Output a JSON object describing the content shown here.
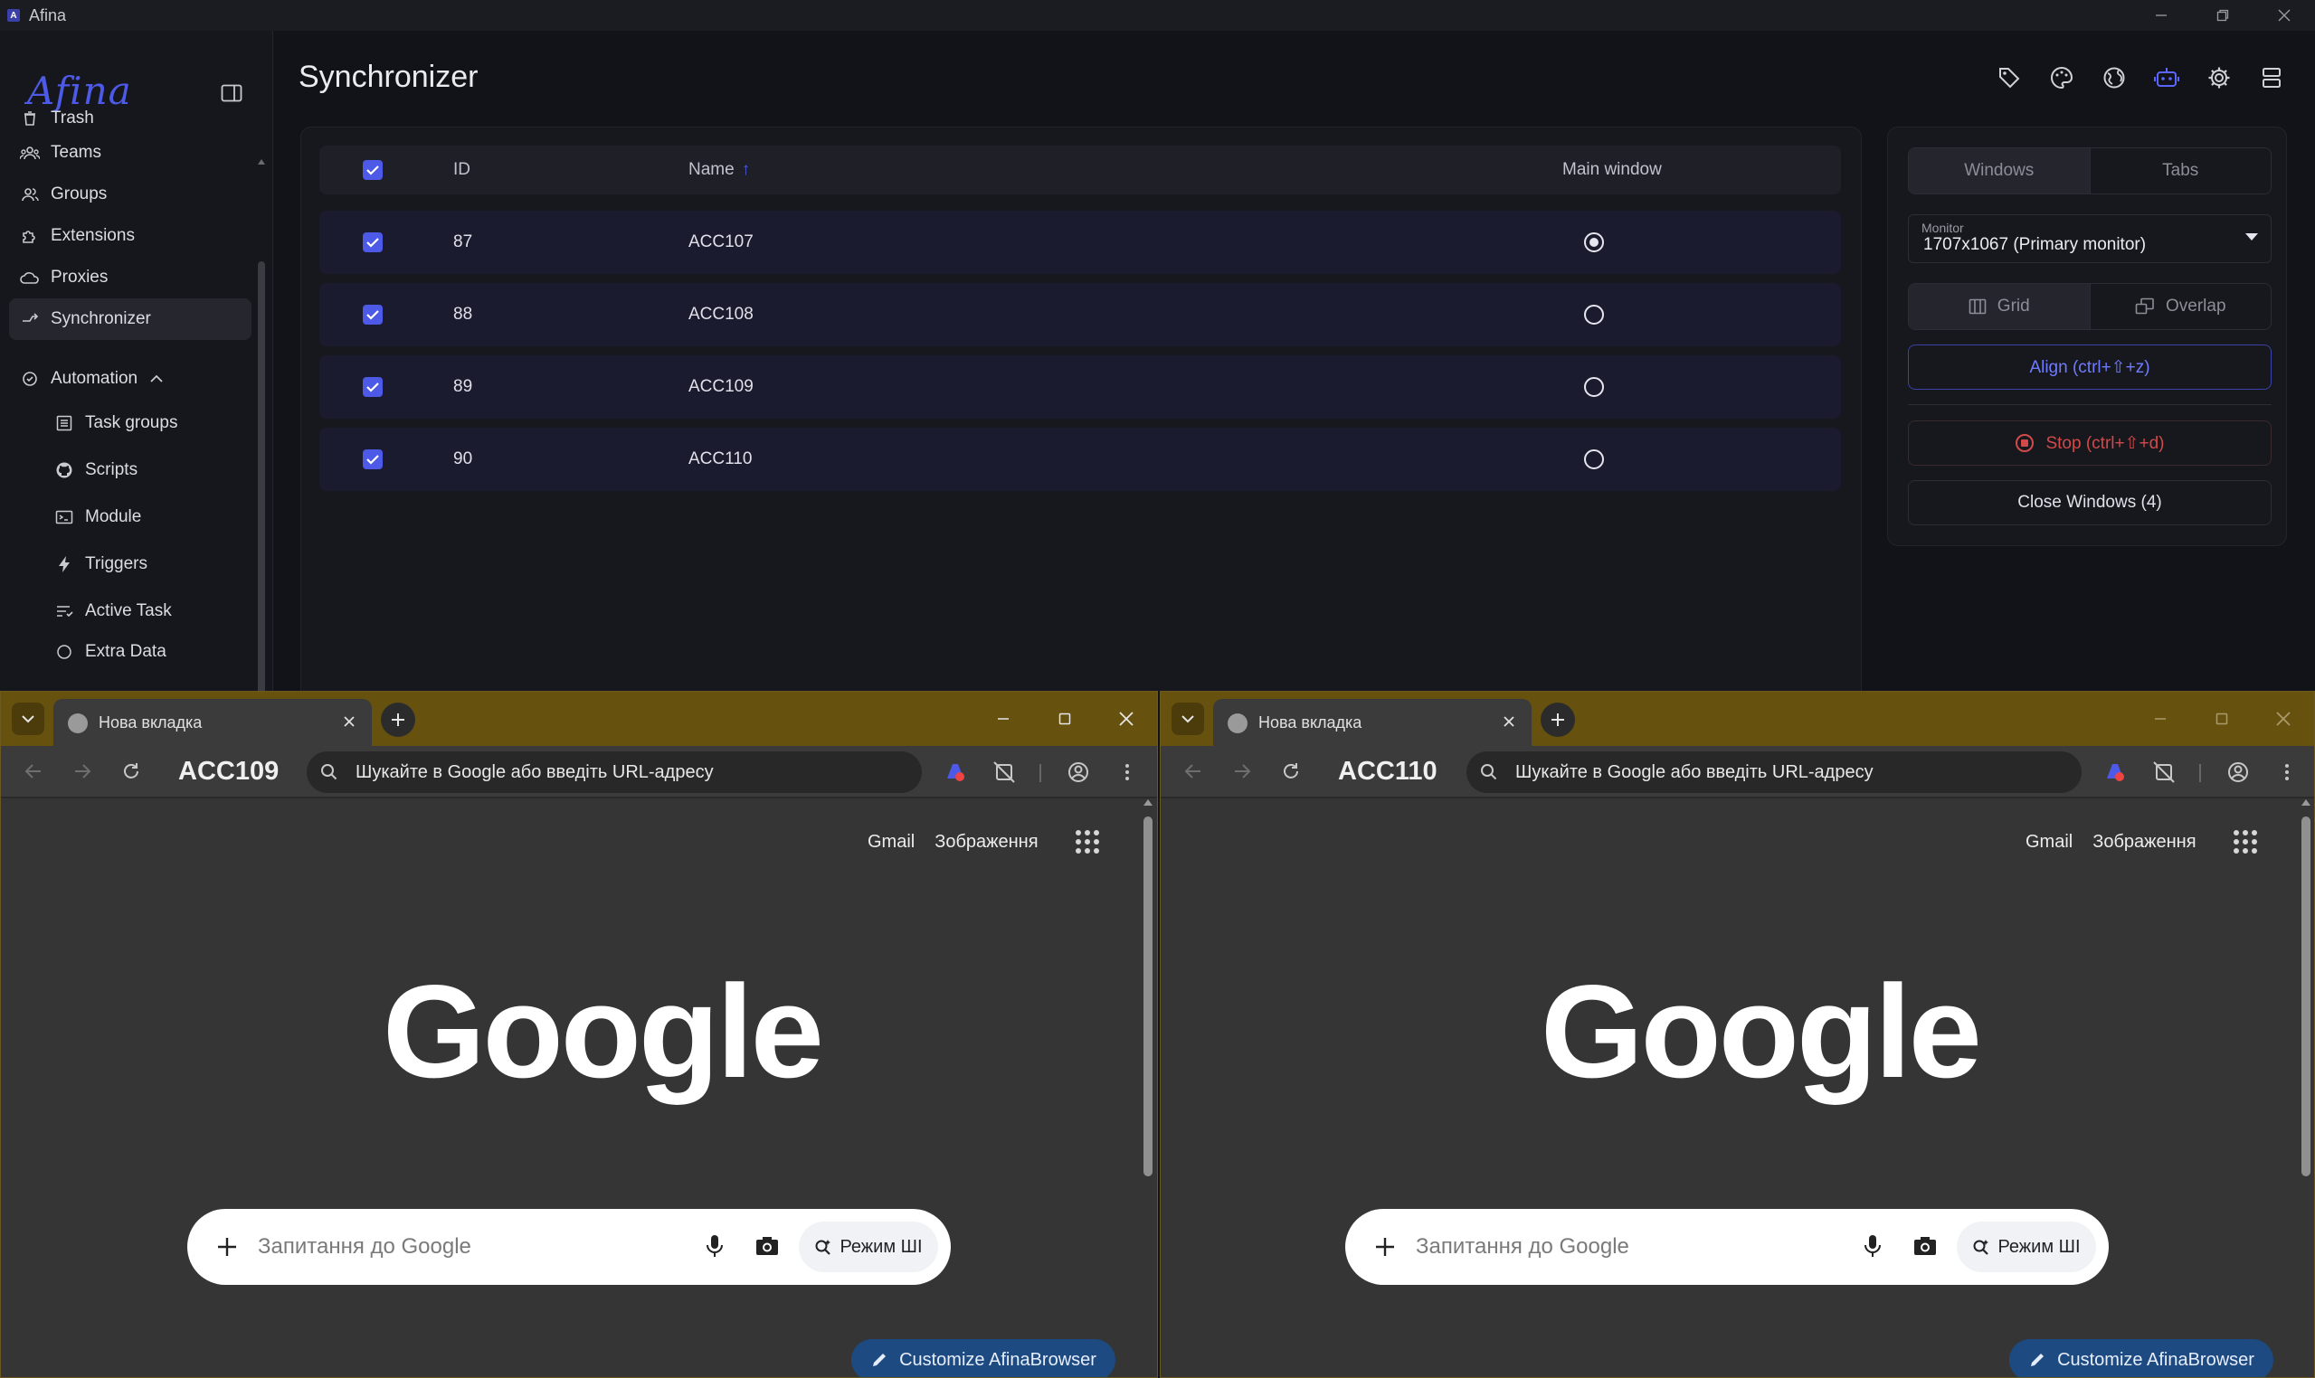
{
  "app": {
    "title": "Afina",
    "logo_text": "Afina",
    "page_title": "Synchronizer",
    "accent_color": "#4d5ae8"
  },
  "sidebar": {
    "items": [
      {
        "label": "Trash",
        "icon": "trash-icon"
      },
      {
        "label": "Teams",
        "icon": "teams-icon"
      },
      {
        "label": "Groups",
        "icon": "groups-icon"
      },
      {
        "label": "Extensions",
        "icon": "puzzle-icon"
      },
      {
        "label": "Proxies",
        "icon": "cloud-icon"
      },
      {
        "label": "Synchronizer",
        "icon": "sync-icon",
        "active": true
      },
      {
        "label": "Automation",
        "icon": "automation-icon",
        "expanded": true
      }
    ],
    "automation_children": [
      {
        "label": "Task groups",
        "icon": "list-icon"
      },
      {
        "label": "Scripts",
        "icon": "github-icon"
      },
      {
        "label": "Module",
        "icon": "terminal-icon"
      },
      {
        "label": "Triggers",
        "icon": "bolt-icon"
      },
      {
        "label": "Active Task",
        "icon": "active-task-icon"
      },
      {
        "label": "Extra Data",
        "icon": "extra-data-icon"
      }
    ]
  },
  "toolbar_icons": [
    "tag-icon",
    "palette-icon",
    "globe-icon",
    "robot-icon",
    "gear-icon",
    "storage-icon"
  ],
  "table": {
    "headers": {
      "id": "ID",
      "name": "Name",
      "main_window": "Main window"
    },
    "sort_indicator": "↑",
    "rows": [
      {
        "id": "87",
        "name": "ACC107",
        "checked": true,
        "main": true
      },
      {
        "id": "88",
        "name": "ACC108",
        "checked": true,
        "main": false
      },
      {
        "id": "89",
        "name": "ACC109",
        "checked": true,
        "main": false
      },
      {
        "id": "90",
        "name": "ACC110",
        "checked": true,
        "main": false
      }
    ]
  },
  "right_panel": {
    "tabs": [
      "Windows",
      "Tabs"
    ],
    "selected_tab": "Windows",
    "monitor_label": "Monitor",
    "monitor_value": "1707x1067 (Primary monitor)",
    "layout_options": [
      "Grid",
      "Overlap"
    ],
    "selected_layout": "Grid",
    "align_label": "Align (ctrl+⇧+z)",
    "stop_label": "Stop (ctrl+⇧+d)",
    "close_label": "Close Windows (4)"
  },
  "browsers": [
    {
      "tab_title": "Нова вкладка",
      "profile": "ACC109",
      "omnibox": "Шукайте в Google або введіть URL-адресу",
      "gmail": "Gmail",
      "images": "Зображення",
      "logo": "Google",
      "search_placeholder": "Запитання до Google",
      "ai_mode": "Режим ШІ",
      "customize": "Customize AfinaBrowser"
    },
    {
      "tab_title": "Нова вкладка",
      "profile": "ACC110",
      "omnibox": "Шукайте в Google або введіть URL-адресу",
      "gmail": "Gmail",
      "images": "Зображення",
      "logo": "Google",
      "search_placeholder": "Запитання до Google",
      "ai_mode": "Режим ШІ",
      "customize": "Customize AfinaBrowser"
    }
  ]
}
